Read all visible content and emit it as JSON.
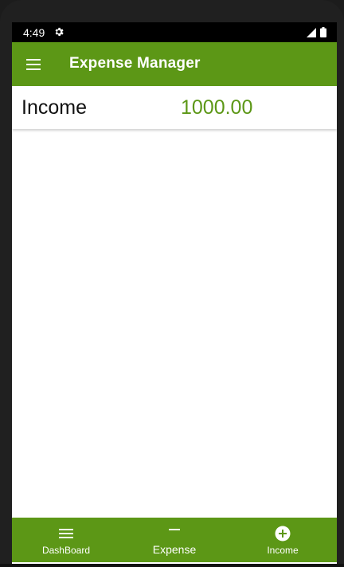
{
  "status_bar": {
    "time": "4:49",
    "gear_icon": "gear-icon",
    "signal_icon": "signal-icon",
    "battery_icon": "battery-icon"
  },
  "app_bar": {
    "title": "Expense Manager",
    "menu_icon": "menu-icon",
    "background_color": "#5c9716"
  },
  "summary": {
    "label": "Income",
    "amount": "1000.00",
    "amount_color": "#5c9716"
  },
  "bottom_nav": {
    "items": [
      {
        "label": "DashBoard",
        "icon": "list-icon",
        "active": false
      },
      {
        "label": "Expense",
        "icon": "minus-icon",
        "active": true
      },
      {
        "label": "Income",
        "icon": "add-circle-icon",
        "active": false
      }
    ]
  }
}
